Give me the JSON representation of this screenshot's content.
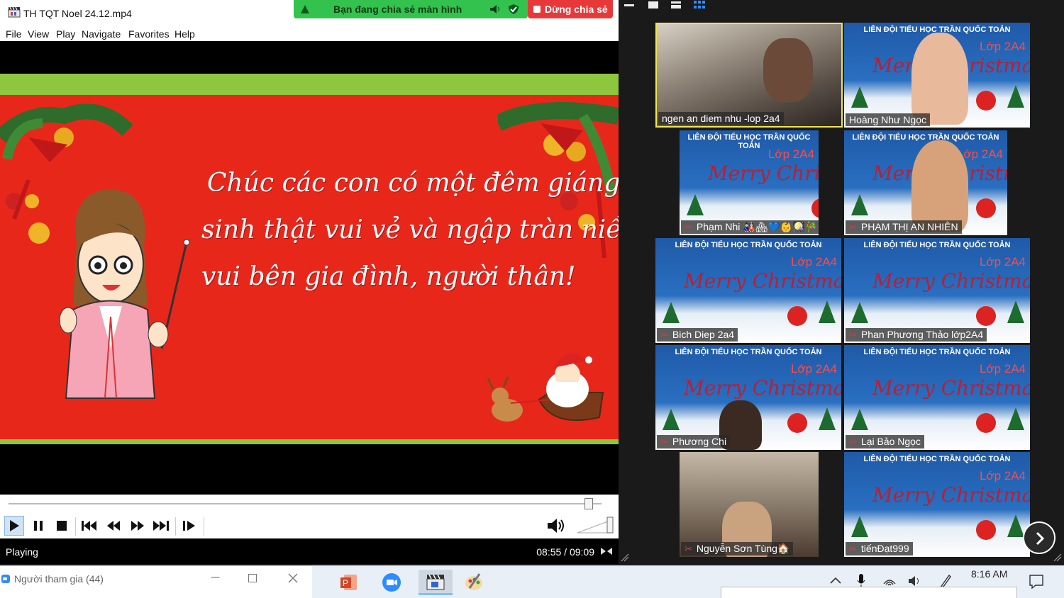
{
  "player": {
    "title": "TH TQT Noel 24.12.mp4",
    "menu": [
      "File",
      "View",
      "Play",
      "Navigate",
      "Favorites",
      "Help"
    ],
    "slide_text": [
      "Chúc các con có một đêm giáng",
      "sinh thật vui vẻ và ngập tràn niềm",
      "vui bên gia đình, người thân!"
    ],
    "status": "Playing",
    "time": "08:55 / 09:09",
    "seek_fraction": 0.978,
    "colors": {
      "slide_red": "#e8271b",
      "band_green": "#8dc63f"
    }
  },
  "share": {
    "banner_text": "Bạn đang chia sẻ màn hình",
    "stop_label": "Dừng chia sẻ"
  },
  "gallery": {
    "participants": [
      {
        "name": "ngen an diem nhu  -lop 2a4",
        "muted": false,
        "active": true,
        "bg": "video"
      },
      {
        "name": "Hoàng Như Ngọc",
        "muted": false,
        "active": false,
        "bg": "xmas"
      },
      {
        "name": "Phạm Nhi 🎎🏘💙👶🎑🎋🎡🇻🇳",
        "muted": true,
        "active": false,
        "bg": "xmas"
      },
      {
        "name": "PHẠM THỊ AN NHIÊN",
        "muted": true,
        "active": false,
        "bg": "xmas"
      },
      {
        "name": "Bich Diep 2a4",
        "muted": true,
        "active": false,
        "bg": "xmas"
      },
      {
        "name": "Phan Phương Thảo lớp2A4",
        "muted": true,
        "active": false,
        "bg": "xmas"
      },
      {
        "name": "Phương Chi",
        "muted": true,
        "active": false,
        "bg": "xmas"
      },
      {
        "name": "Lại Bảo Ngọc",
        "muted": true,
        "active": false,
        "bg": "xmas"
      },
      {
        "name": "Nguyễn Sơn Tùng🏠",
        "muted": true,
        "active": false,
        "bg": "video"
      },
      {
        "name": "tiếnĐạt999",
        "muted": true,
        "active": false,
        "bg": "xmas"
      }
    ],
    "tile_header": "LIÊN ĐỘI TIỂU HỌC TRẦN QUỐC TOẢN",
    "tile_class": "Lớp 2A4",
    "tile_merry": "Merry Christmas"
  },
  "participants_window": {
    "title": "Người tham gia (44)"
  },
  "taskbar": {
    "clock": "8:16 AM"
  }
}
